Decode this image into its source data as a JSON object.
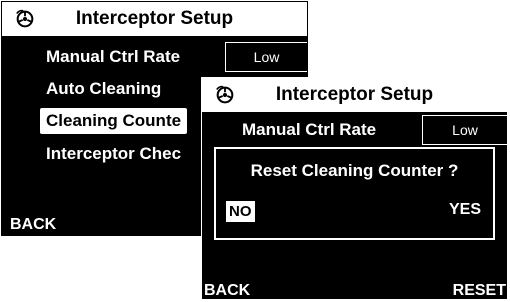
{
  "back_screen": {
    "title": "Interceptor Setup",
    "icon": "wheel-icon",
    "menu_items": [
      {
        "label": "Manual Ctrl Rate"
      },
      {
        "label": "Auto Cleaning"
      },
      {
        "label": "Cleaning Counte"
      },
      {
        "label": "Interceptor Chec"
      }
    ],
    "manual_ctrl_rate_value": "Low",
    "softkey_left": "BACK"
  },
  "front_screen": {
    "title": "Interceptor Setup",
    "icon": "wheel-icon",
    "menu_item": "Manual Ctrl Rate",
    "manual_ctrl_rate_value": "Low",
    "dialog": {
      "question": "Reset Cleaning Counter ?",
      "option_no": "NO",
      "option_yes": "YES"
    },
    "softkey_left": "BACK",
    "softkey_right": "RESET"
  },
  "colors": {
    "screen_bg": "#000000",
    "foreground": "#ffffff"
  }
}
